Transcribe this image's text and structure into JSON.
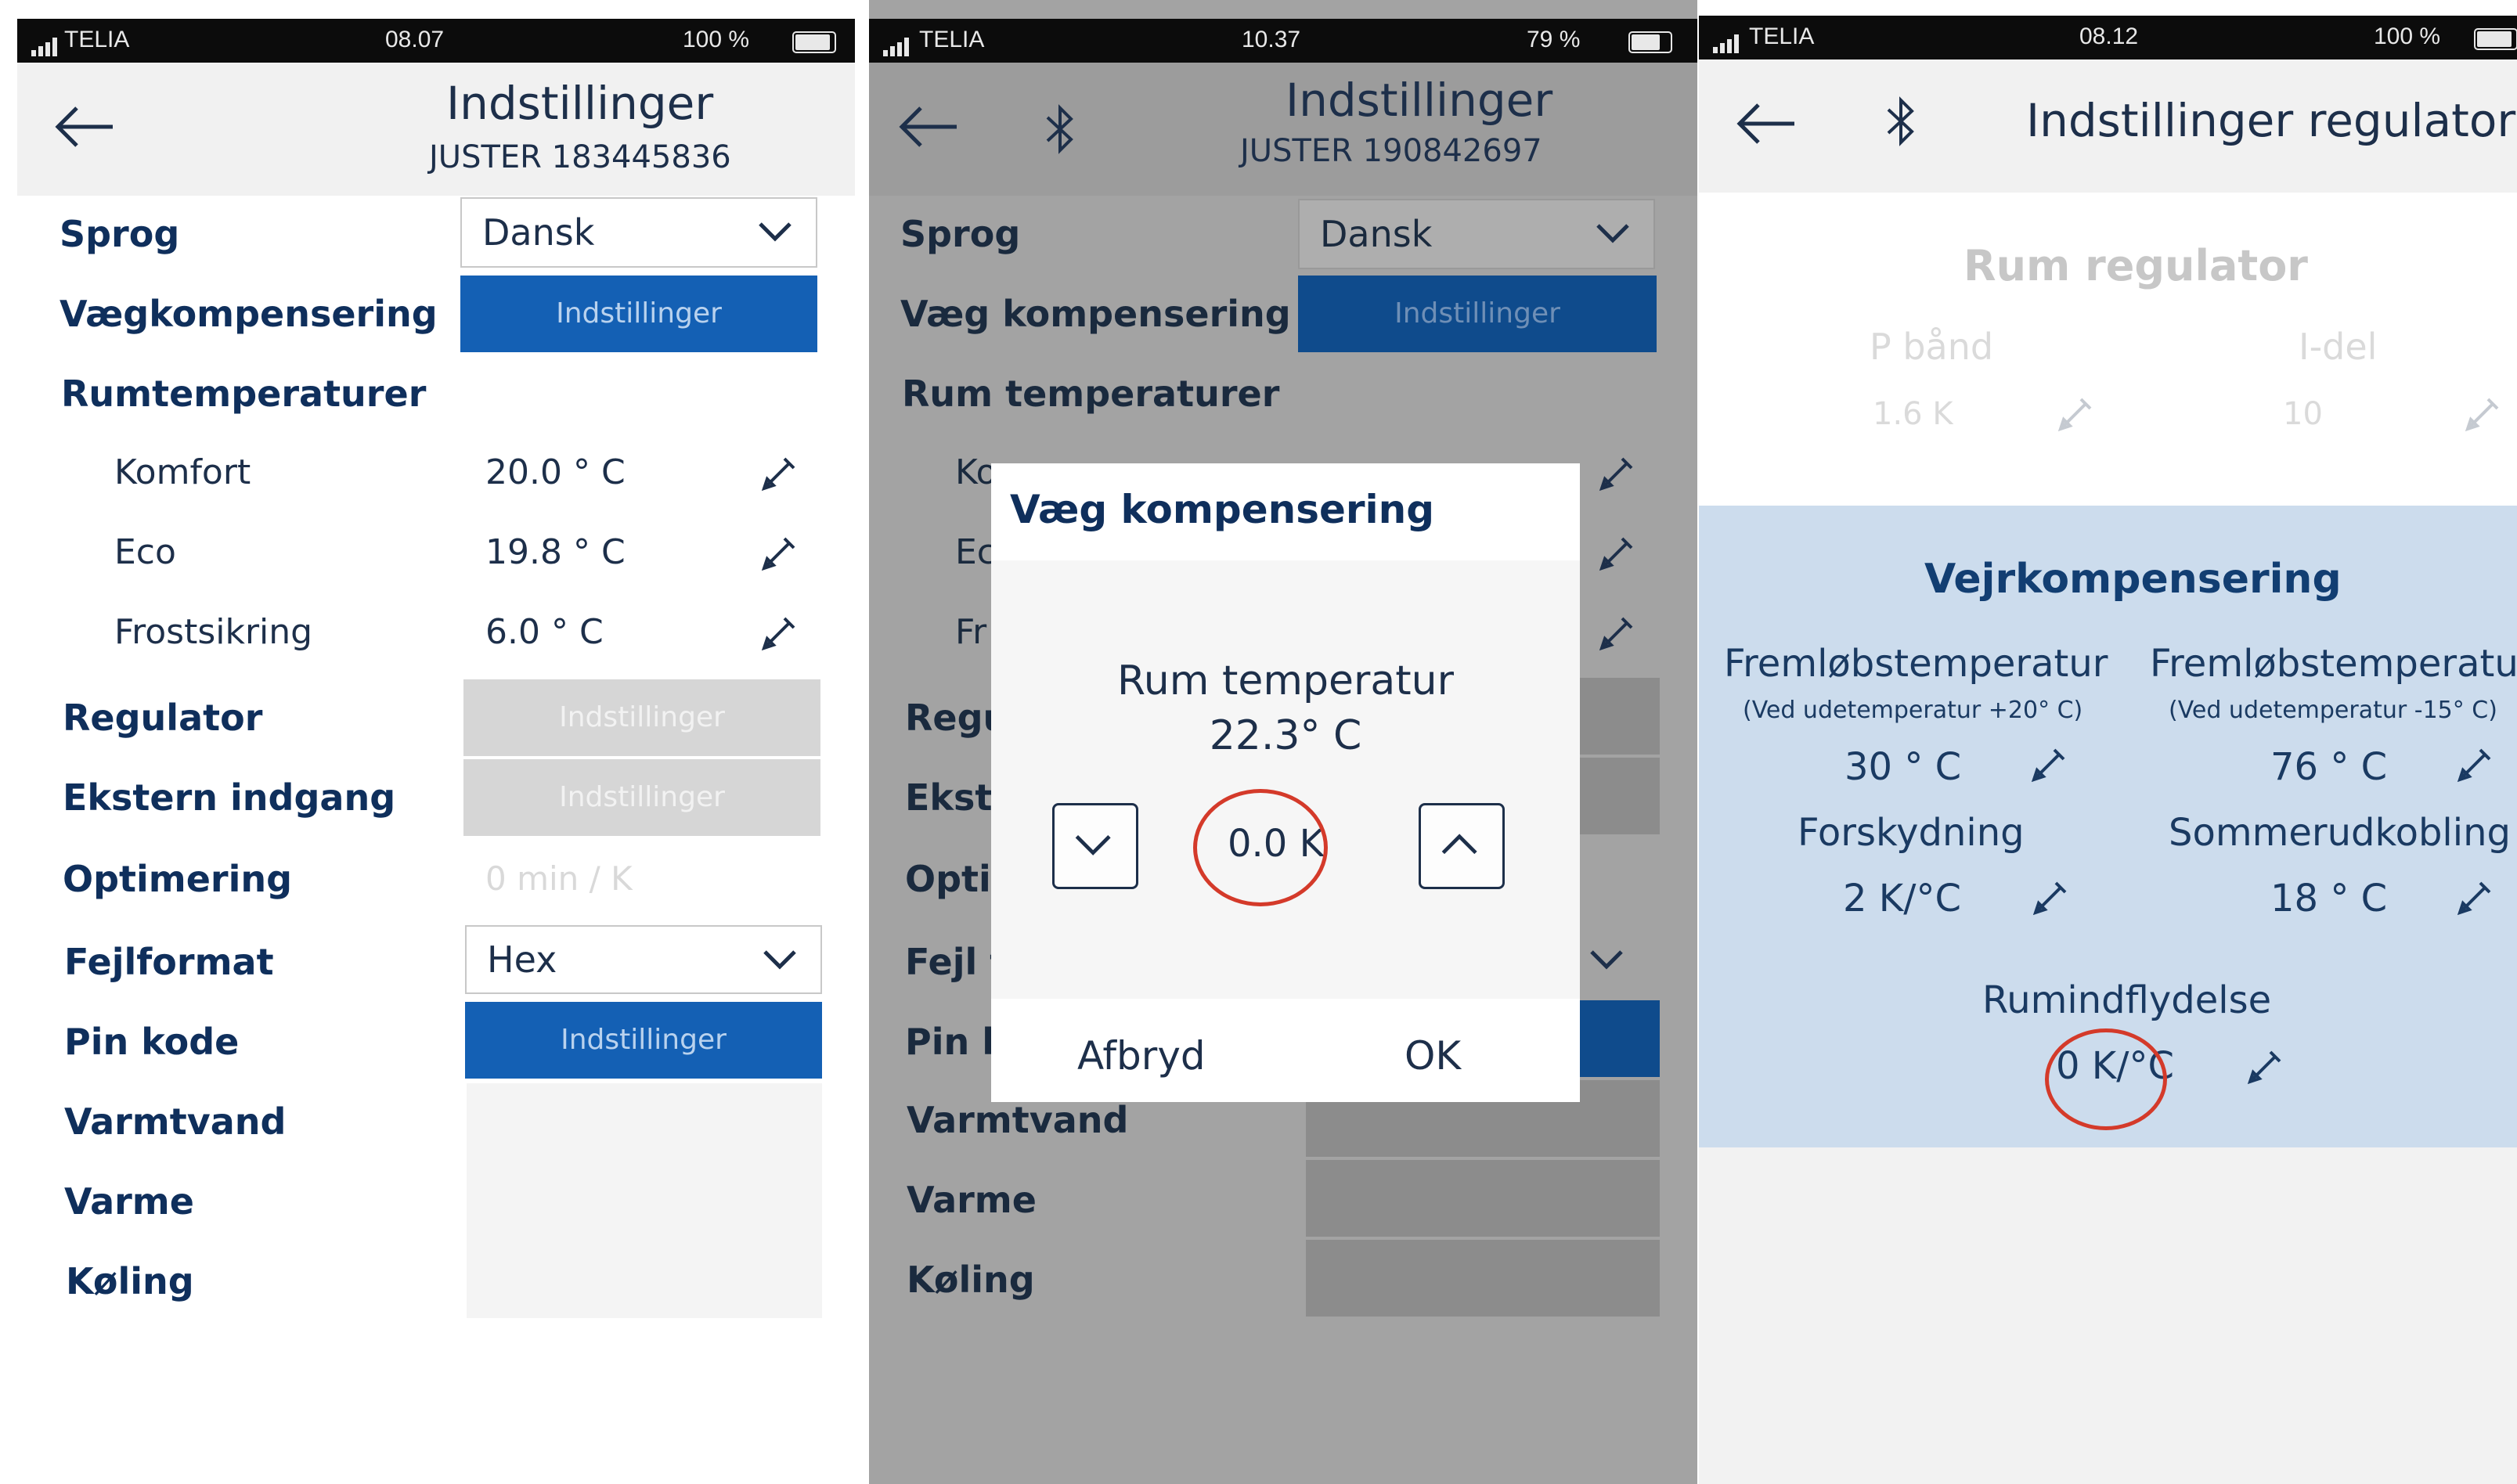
{
  "colors": {
    "accent": "#1460b4",
    "highlight_circle": "#d43a2a",
    "section_bg": "#ccdced"
  },
  "panel1": {
    "status": {
      "carrier": "TELIA",
      "time": "08.07",
      "battery": "100 %"
    },
    "header": {
      "title": "Indstillinger",
      "subtitle": "JUSTER 183445836"
    },
    "sprog": {
      "label": "Sprog",
      "value": "Dansk"
    },
    "vaeg": {
      "label": "Vægkompensering",
      "button": "Indstillinger"
    },
    "rum": {
      "label": "Rumtemperaturer"
    },
    "komfort": {
      "label": "Komfort",
      "value": "20.0 ° C"
    },
    "eco": {
      "label": "Eco",
      "value": "19.8 ° C"
    },
    "frost": {
      "label": "Frostsikring",
      "value": "6.0 ° C"
    },
    "regulator": {
      "label": "Regulator",
      "button": "Indstillinger"
    },
    "ekstern": {
      "label": "Ekstern indgang",
      "button": "Indstillinger"
    },
    "optimering": {
      "label": "Optimering",
      "value": "0 min / K"
    },
    "fejlformat": {
      "label": "Fejlformat",
      "value": "Hex"
    },
    "pinkode": {
      "label": "Pin kode",
      "button": "Indstillinger"
    },
    "varmtvand": {
      "label": "Varmtvand"
    },
    "varme": {
      "label": "Varme"
    },
    "koeling": {
      "label": "Køling"
    }
  },
  "panel2": {
    "status": {
      "carrier": "TELIA",
      "time": "10.37",
      "battery": "79 %"
    },
    "header": {
      "title": "Indstillinger",
      "subtitle": "JUSTER 190842697"
    },
    "sprog": {
      "label": "Sprog",
      "value": "Dansk"
    },
    "vaeg": {
      "label": "Væg kompensering",
      "button": "Indstillinger"
    },
    "rum": {
      "label": "Rum temperaturer"
    },
    "partial": {
      "ko": "Ko",
      "ec": "Ec",
      "fr": "Fr",
      "regu": "Regu",
      "ekste": "Ekste",
      "optir": "Optir",
      "fejl": "Fejl t",
      "pink": "Pin k"
    },
    "varmtvand": {
      "label": "Varmtvand"
    },
    "varme": {
      "label": "Varme"
    },
    "koeling": {
      "label": "Køling"
    },
    "dialog": {
      "title": "Væg kompensering",
      "line1": "Rum temperatur",
      "line2": "22.3° C",
      "value": "0.0 K",
      "cancel": "Afbryd",
      "ok": "OK"
    }
  },
  "panel3": {
    "status": {
      "carrier": "TELIA",
      "time": "08.12",
      "battery": "100 %"
    },
    "header": {
      "title": "Indstillinger regulator"
    },
    "rum_regulator": {
      "title": "Rum regulator",
      "pband_label": "P bånd",
      "pband_value": "1.6 K",
      "idel_label": "I-del",
      "idel_value": "10"
    },
    "vejr": {
      "title": "Vejrkompensering",
      "frem1_label": "Fremløbstemperatur",
      "frem1_sub": "(Ved udetemperatur +20° C)",
      "frem1_value": "30 ° C",
      "frem2_label": "Fremløbstemperatur",
      "frem2_sub": "(Ved udetemperatur -15° C)",
      "frem2_value": "76 ° C",
      "forskydning_label": "Forskydning",
      "forskydning_value": "2 K/°C",
      "sommer_label": "Sommerudkobling",
      "sommer_value": "18 ° C",
      "rumindflydelse_label": "Rumindflydelse",
      "rumindflydelse_value": "0 K/°C"
    }
  }
}
